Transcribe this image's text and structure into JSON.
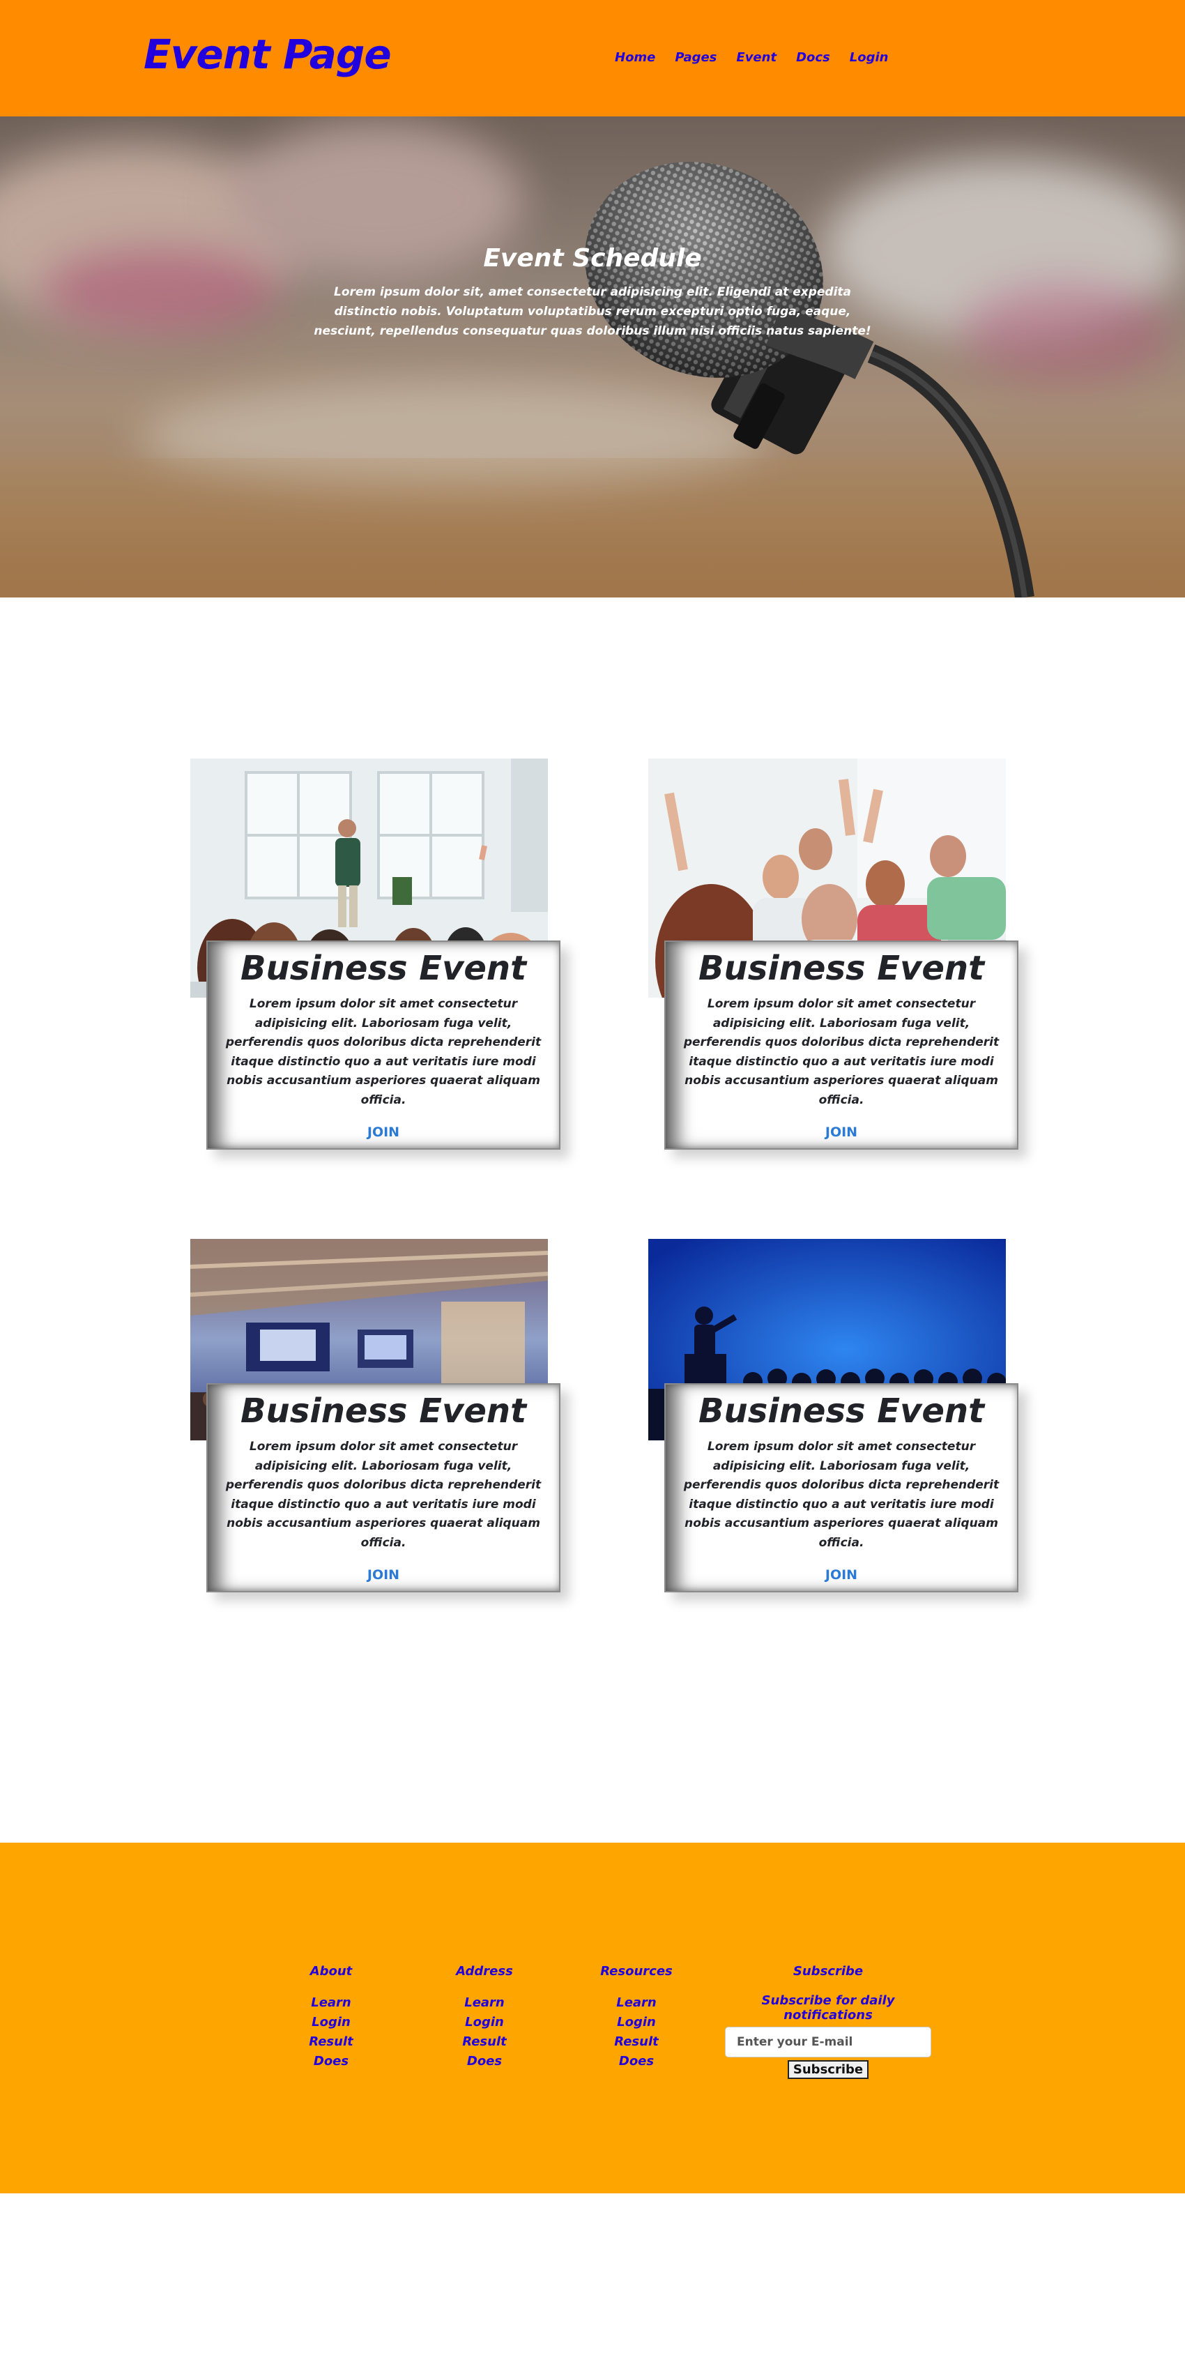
{
  "header": {
    "logo": "Event Page",
    "nav": [
      "Home",
      "Pages",
      "Event",
      "Docs",
      "Login"
    ]
  },
  "hero": {
    "title": "Event Schedule",
    "text": "Lorem ipsum dolor sit, amet consectetur adipisicing elit. Eligendi at expedita distinctio nobis. Voluptatum voluptatibus rerum excepturi optio fuga, eaque, nesciunt, repellendus consequatur quas doloribus illum nisi officiis natus sapiente!"
  },
  "cards": [
    {
      "title": "Business Event",
      "text": "Lorem ipsum dolor sit amet consectetur adipisicing elit. Laboriosam fuga velit, perferendis quos doloribus dicta reprehenderit itaque distinctio quo a aut veritatis iure modi nobis accusantium asperiores quaerat aliquam officia.",
      "link": "JOIN",
      "image": "presenter-audience-photo"
    },
    {
      "title": "Business Event",
      "text": "Lorem ipsum dolor sit amet consectetur adipisicing elit. Laboriosam fuga velit, perferendis quos doloribus dicta reprehenderit itaque distinctio quo a aut veritatis iure modi nobis accusantium asperiores quaerat aliquam officia.",
      "link": "JOIN",
      "image": "audience-raising-hands-photo"
    },
    {
      "title": "Business Event",
      "text": "Lorem ipsum dolor sit amet consectetur adipisicing elit. Laboriosam fuga velit, perferendis quos doloribus dicta reprehenderit itaque distinctio quo a aut veritatis iure modi nobis accusantium asperiores quaerat aliquam officia.",
      "link": "JOIN",
      "image": "conference-hall-photo"
    },
    {
      "title": "Business Event",
      "text": "Lorem ipsum dolor sit amet consectetur adipisicing elit. Laboriosam fuga velit, perferendis quos doloribus dicta reprehenderit itaque distinctio quo a aut veritatis iure modi nobis accusantium asperiores quaerat aliquam officia.",
      "link": "JOIN",
      "image": "speaker-silhouette-photo"
    }
  ],
  "footer": {
    "columns": [
      {
        "heading": "About",
        "items": [
          "Learn",
          "Login",
          "Result",
          "Does"
        ]
      },
      {
        "heading": "Address",
        "items": [
          "Learn",
          "Login",
          "Result",
          "Does"
        ]
      },
      {
        "heading": "Resources",
        "items": [
          "Learn",
          "Login",
          "Result",
          "Does"
        ]
      }
    ],
    "subscribe": {
      "heading": "Subscribe",
      "note": "Subscribe for daily notifications",
      "placeholder": "Enter your E-mail",
      "button": "Subscribe"
    }
  },
  "colors": {
    "header_bg": "#ff8c00",
    "footer_bg": "#ffa500",
    "link_blue": "#2200dd",
    "join_blue": "#2a7ad6"
  }
}
